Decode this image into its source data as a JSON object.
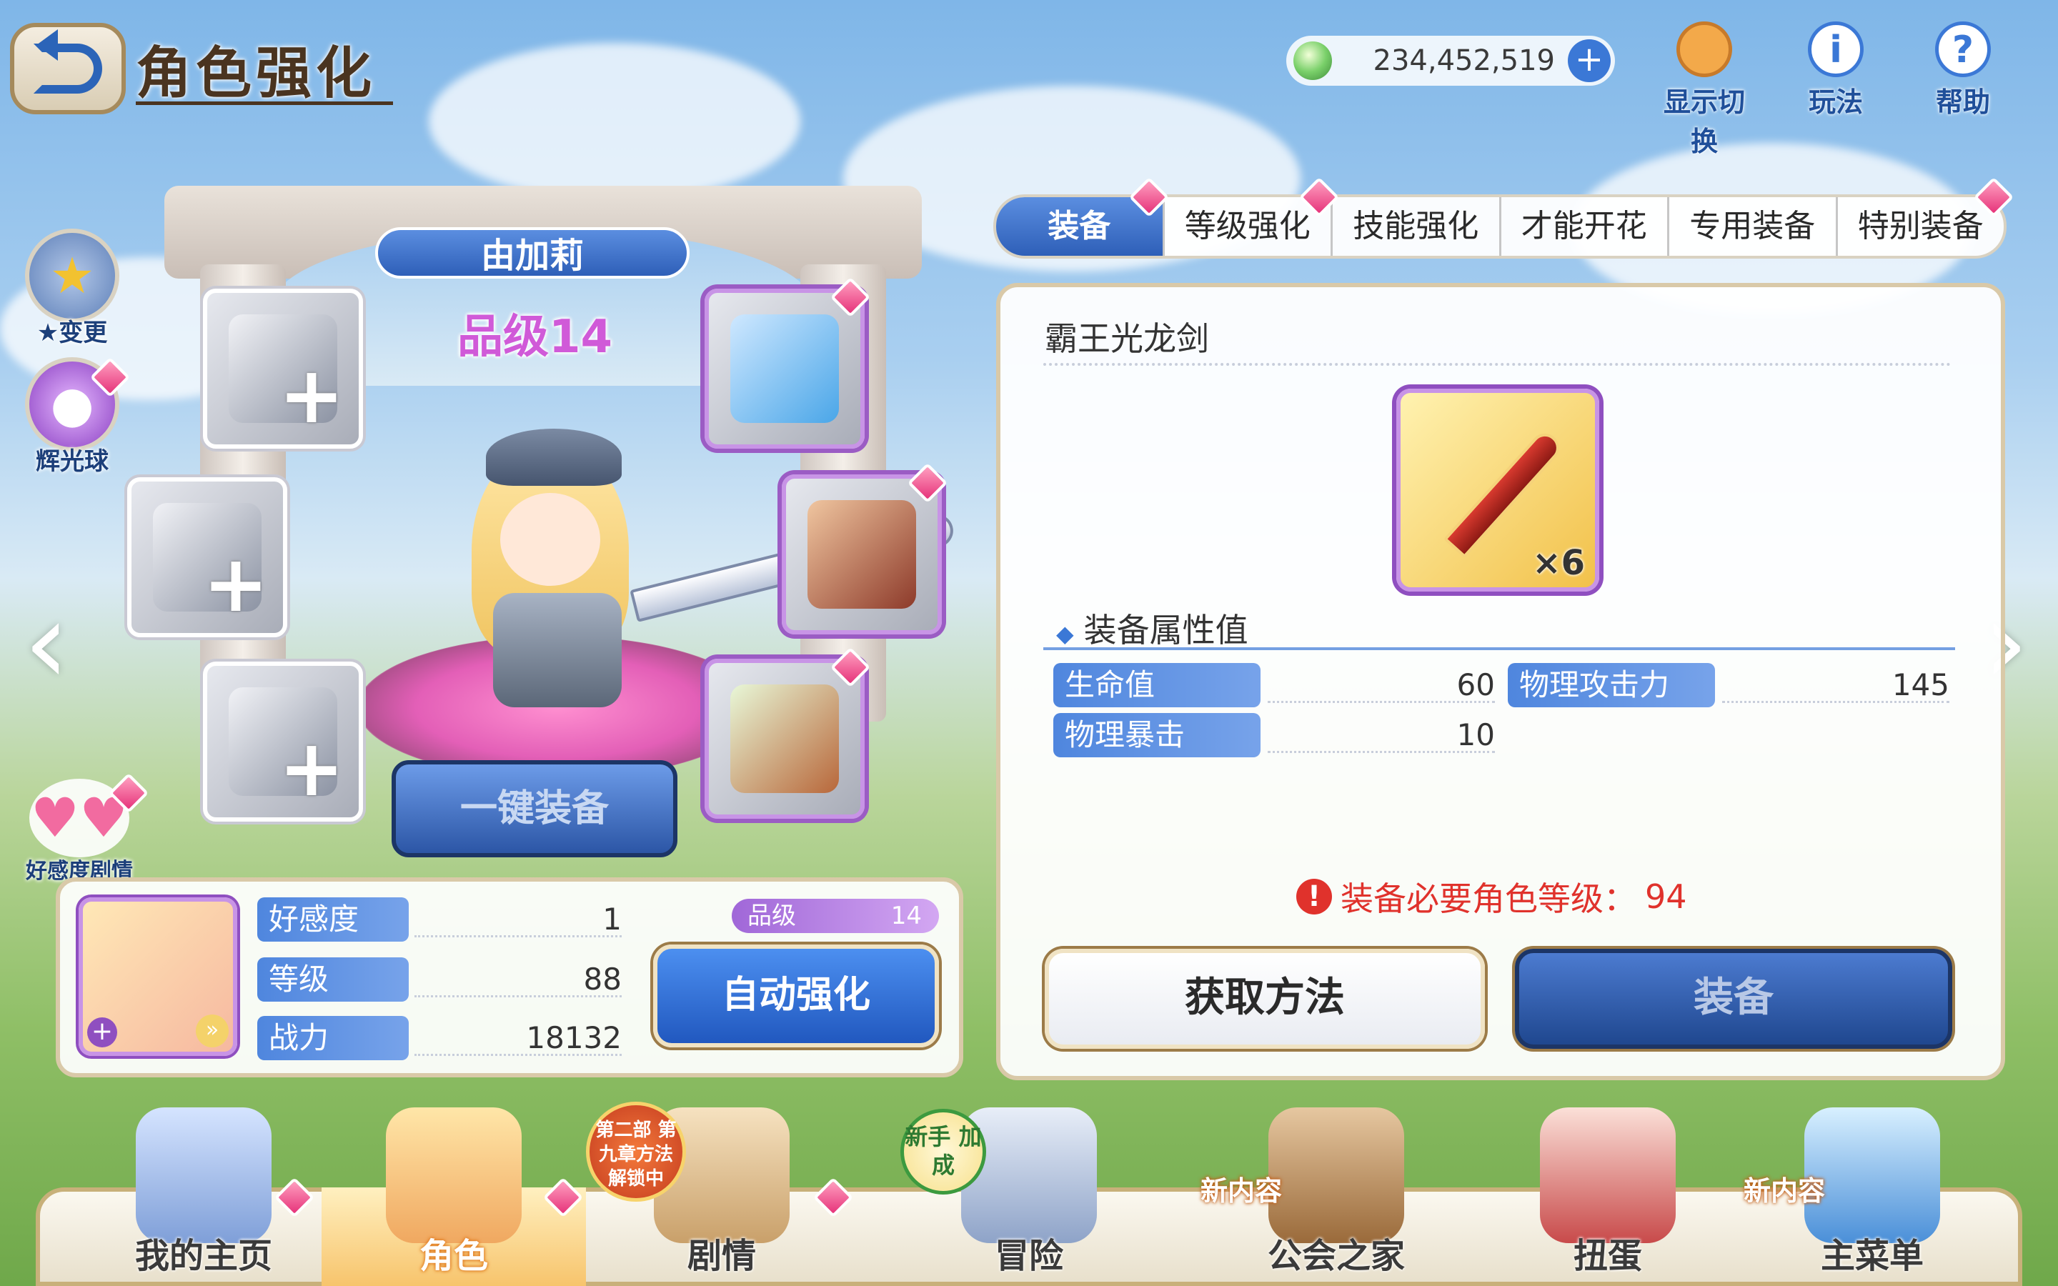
{
  "header": {
    "title": "角色强化",
    "currency": "234,452,519",
    "currency_plus": "+",
    "icons": [
      {
        "label": "显示切换",
        "icon": "display-switch-icon"
      },
      {
        "label": "玩法",
        "icon": "info-icon",
        "glyph": "i"
      },
      {
        "label": "帮助",
        "icon": "help-icon",
        "glyph": "?"
      }
    ]
  },
  "side": {
    "change_star": "★变更",
    "glow_orb": "辉光球",
    "favor_story": "好感度剧情"
  },
  "character": {
    "name": "由加莉",
    "rank_text": "品级14",
    "one_key_equip": "一键装备",
    "prev_arrow": "‹",
    "next_arrow": "›"
  },
  "info": {
    "rank_label": "品级",
    "rank_value": "14",
    "stats": [
      {
        "label": "好感度",
        "value": "1"
      },
      {
        "label": "等级",
        "value": "88"
      },
      {
        "label": "战力",
        "value": "18132"
      }
    ],
    "auto_enhance": "自动强化"
  },
  "tabs": [
    {
      "label": "装备",
      "active": true
    },
    {
      "label": "等级强化",
      "active": false
    },
    {
      "label": "技能强化",
      "active": false
    },
    {
      "label": "才能开花",
      "active": false
    },
    {
      "label": "专用装备",
      "active": false
    },
    {
      "label": "特别装备",
      "active": false
    }
  ],
  "equipment": {
    "name": "霸王光龙剑",
    "count": "×6",
    "attr_title": "装备属性值",
    "attributes": [
      {
        "label": "生命值",
        "value": "60"
      },
      {
        "label": "物理攻击力",
        "value": "145"
      },
      {
        "label": "物理暴击",
        "value": "10"
      }
    ],
    "requirement_prefix": "装备必要角色等级：",
    "requirement_level": "94",
    "obtain_button": "获取方法",
    "equip_button": "装备"
  },
  "bottom_nav": [
    {
      "label": "我的主页",
      "active": false
    },
    {
      "label": "角色",
      "active": true
    },
    {
      "label": "剧情",
      "active": false,
      "badge": "第二部 第九章方法 解锁中"
    },
    {
      "label": "冒险",
      "active": false,
      "badge": "新手 加成"
    },
    {
      "label": "公会之家",
      "active": false,
      "badge": "新内容"
    },
    {
      "label": "扭蛋",
      "active": false
    },
    {
      "label": "主菜单",
      "active": false,
      "badge": "新内容"
    }
  ],
  "colors": {
    "accent_blue": "#2e5fb8",
    "rank_purple": "#d05ad8",
    "warning_red": "#e0322c",
    "notify_pink": "#e6337a"
  }
}
